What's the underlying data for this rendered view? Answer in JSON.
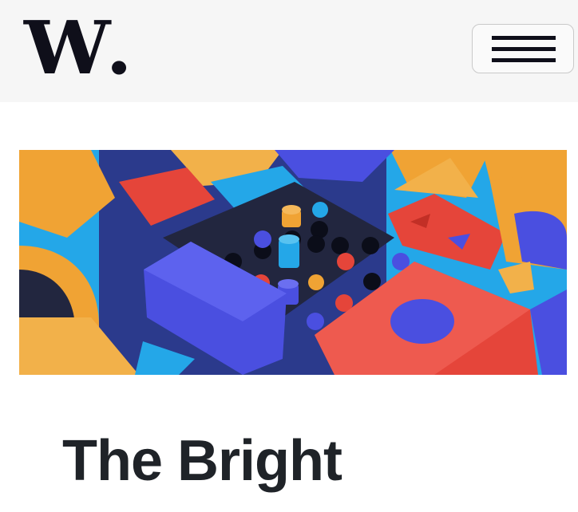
{
  "header": {
    "logo_text": "W",
    "logo_dot": ".",
    "menu_icon": "hamburger-menu-icon"
  },
  "hero": {
    "image_icon": "colorful-3d-blocks-illustration",
    "colors": {
      "orange": "#f0a334",
      "red": "#e5453a",
      "blue": "#4a4fe0",
      "sky": "#24a7e8",
      "navy": "#22263f"
    }
  },
  "article": {
    "title": "The Bright"
  }
}
